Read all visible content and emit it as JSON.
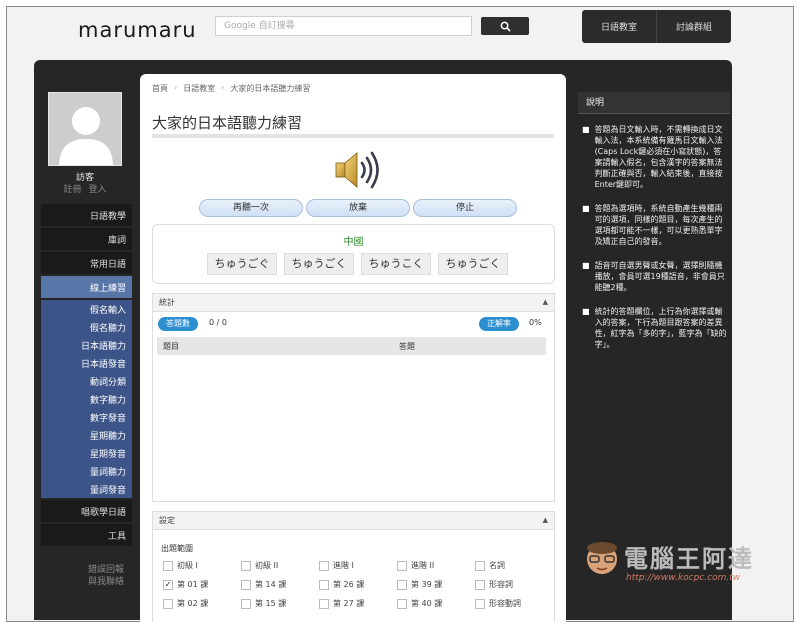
{
  "header": {
    "logo": "marumaru",
    "search_placeholder": "Google 自訂搜尋",
    "nav": [
      "日語教室",
      "討論群組"
    ]
  },
  "user": {
    "name": "訪客",
    "register": "註冊",
    "login": "登入"
  },
  "sidebar": {
    "items_top": [
      "日語教學",
      "庫詞",
      "常用日語"
    ],
    "active": "線上練習",
    "sub_items": [
      "假名輸入",
      "假名聽力",
      "日本語聽力",
      "日本語發音",
      "動詞分類",
      "數字聽力",
      "數字發音",
      "星期聽力",
      "星期發音",
      "量詞聽力",
      "量詞發音"
    ],
    "items_bottom": [
      "唱歌學日語",
      "工具"
    ],
    "footer": [
      "錯誤回報",
      "與我聯絡"
    ]
  },
  "breadcrumb": [
    "首頁",
    "日語教室",
    "大家的日本語聽力練習"
  ],
  "page_title": "大家的日本語聽力練習",
  "controls": [
    "再聽一次",
    "放棄",
    "停止"
  ],
  "question": {
    "prompt": "中國",
    "choices": [
      "ちゅうごぐ",
      "ちゅうごく",
      "ちゅうこく",
      "ちゅうごく"
    ]
  },
  "stats": {
    "header": "統計",
    "count_label": "答題數",
    "count_value": "0 / 0",
    "rate_label": "正解率",
    "rate_value": "0%",
    "col_question": "題目",
    "col_answer": "答題"
  },
  "settings": {
    "header": "設定",
    "range_label": "出題範圍",
    "options": [
      [
        {
          "label": "初級 I",
          "checked": false
        },
        {
          "label": "初級 II",
          "checked": false
        },
        {
          "label": "進階 I",
          "checked": false
        },
        {
          "label": "進階 II",
          "checked": false
        },
        {
          "label": "名詞",
          "checked": false
        }
      ],
      [
        {
          "label": "第 01 課",
          "checked": true
        },
        {
          "label": "第 14 課",
          "checked": false
        },
        {
          "label": "第 26 課",
          "checked": false
        },
        {
          "label": "第 39 課",
          "checked": false
        },
        {
          "label": "形容詞",
          "checked": false
        }
      ],
      [
        {
          "label": "第 02 課",
          "checked": false
        },
        {
          "label": "第 15 課",
          "checked": false
        },
        {
          "label": "第 27 課",
          "checked": false
        },
        {
          "label": "第 40 課",
          "checked": false
        },
        {
          "label": "形容動詞",
          "checked": false
        }
      ]
    ]
  },
  "info": {
    "header": "說明",
    "notes": [
      "答題為日文輸入時，不需轉換成日文輸入法，本系統備有羅馬日文輸入法(Caps Lock鍵必須在小寫狀態)，答案請輸入假名，包含漢字的答案無法判斷正確與否，輸入結束後，直接按Enter鍵即可。",
      "答題為選項時，系統自動產生幾種兩可的選項，同樣的題目，每次產生的選項都可能不一樣，可以更熟悉單字及矯正自己的發音。",
      "語音可自選男聲或女聲，選擇則隨機播放，會員可選19種語音，非會員只能聽2種。",
      "統計的答題欄位，上行為你選擇或輸入的答案，下行為題目跟答案的差異性，紅字為「多的字」，藍字為「缺的字」。"
    ]
  },
  "watermark": {
    "text": "電腦王阿達",
    "url": "http://www.kocpc.com.tw"
  },
  "colors": {
    "sidebar_active": "#5875a8",
    "sidebar_sub": "#3c5487",
    "pill_blue": "#2d8fd0",
    "prompt_green": "#2e8b2e"
  }
}
